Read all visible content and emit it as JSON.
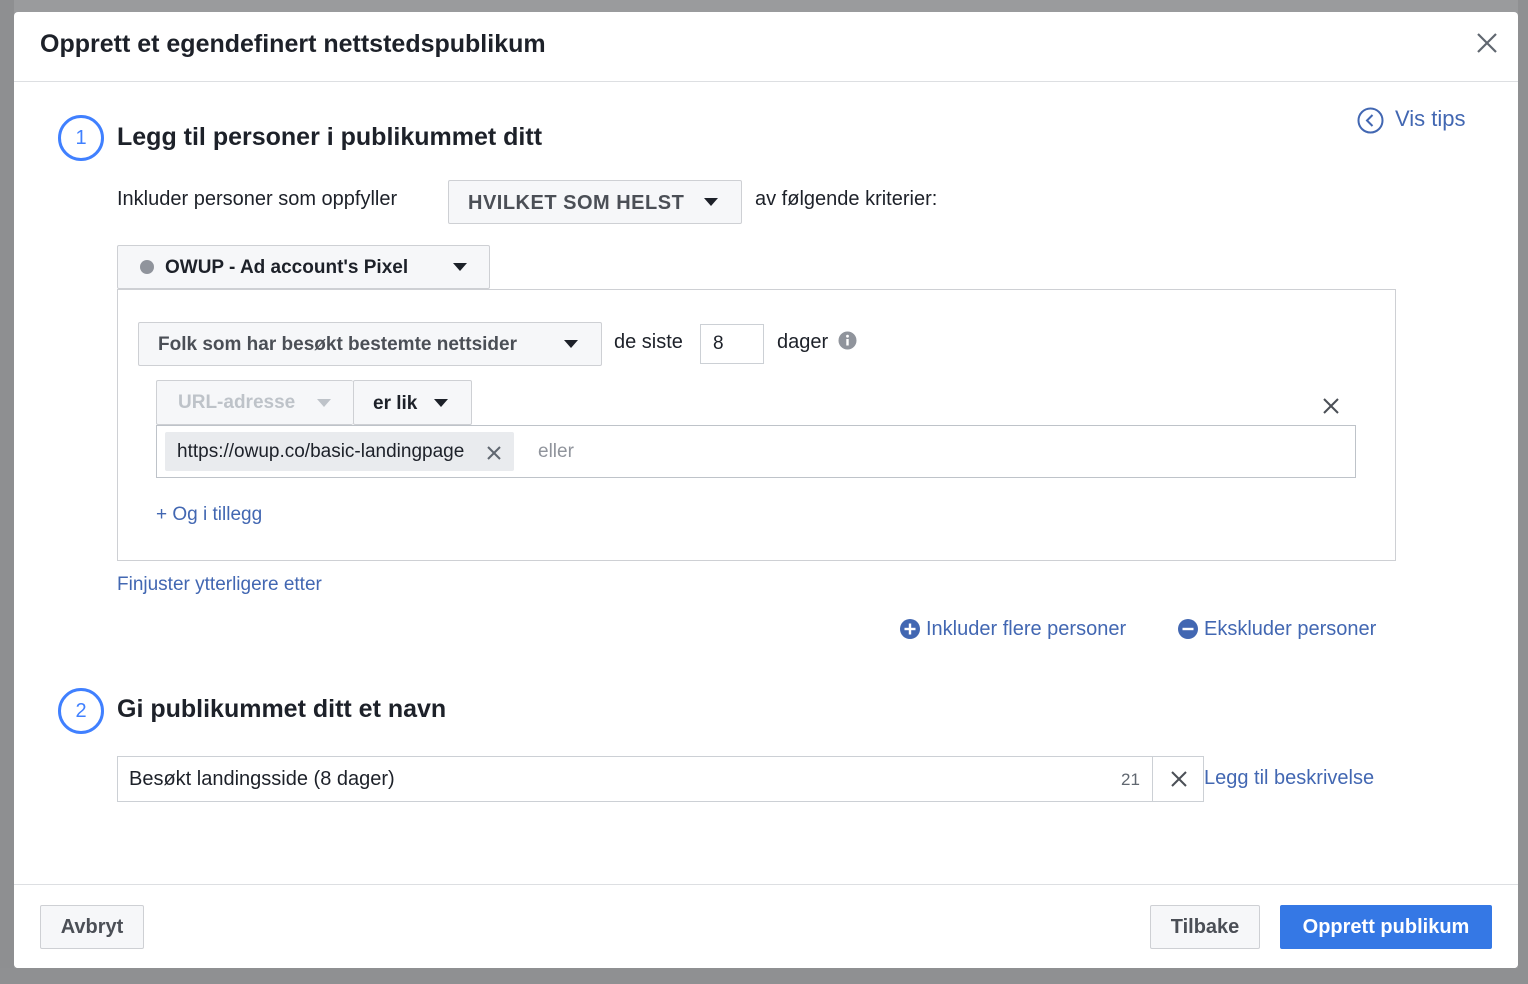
{
  "dialog": {
    "title": "Opprett et egendefinert nettstedspublikum",
    "tips_label": "Vis tips"
  },
  "step1": {
    "number": "1",
    "heading": "Legg til personer i publikummet ditt",
    "include_prefix": "Inkluder personer som oppfyller",
    "match_option": "HVILKET SOM HELST",
    "include_suffix": "av følgende kriterier:",
    "pixel_label": "OWUP - Ad account's Pixel",
    "rule": {
      "event_option": "Folk som har besøkt bestemte nettsider",
      "in_last_label": "de siste",
      "days_value": "8",
      "days_label": "dager",
      "field_option": "URL-adresse",
      "operator_option": "er lik",
      "token_value": "https://owup.co/basic-landingpage",
      "or_placeholder": "eller",
      "and_also_link": "+ Og i tillegg"
    },
    "refine_link": "Finjuster ytterligere etter",
    "include_more_link": "Inkluder flere personer",
    "exclude_link": "Ekskluder personer"
  },
  "step2": {
    "number": "2",
    "heading": "Gi publikummet ditt et navn",
    "name_value": "Besøkt landingsside (8 dager)",
    "char_count": "21",
    "add_description_link": "Legg til beskrivelse"
  },
  "footer": {
    "cancel_label": "Avbryt",
    "back_label": "Tilbake",
    "create_label": "Opprett publikum"
  },
  "colors": {
    "accent": "#4080ff",
    "link": "#4267b2",
    "primary_button": "#3578e5"
  }
}
